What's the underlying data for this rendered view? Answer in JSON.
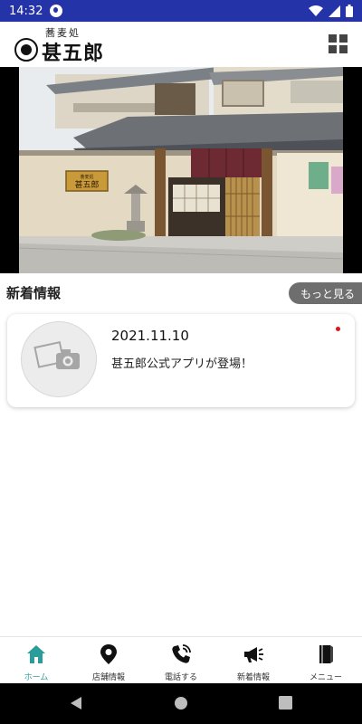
{
  "status_bar": {
    "time": "14:32",
    "bar_color": "#2533a8"
  },
  "header": {
    "logo_small": "蕎麦処",
    "logo_main": "甚五郎",
    "menu_icon": "grid-icon"
  },
  "hero": {
    "signboard_small": "蕎麦処",
    "signboard_main": "甚五郎"
  },
  "news": {
    "heading": "新着情報",
    "more_label": "もっと見る",
    "items": [
      {
        "date": "2021.11.10",
        "text": "甚五郎公式アプリが登場！",
        "unread": true,
        "thumbnail_icon": "photo-placeholder-icon"
      }
    ]
  },
  "bottom_nav": {
    "active_color": "#2a9d9a",
    "items": [
      {
        "label": "ホーム",
        "icon": "home-icon",
        "active": true
      },
      {
        "label": "店舗情報",
        "icon": "map-pin-icon",
        "active": false
      },
      {
        "label": "電話する",
        "icon": "phone-icon",
        "active": false
      },
      {
        "label": "新着情報",
        "icon": "megaphone-icon",
        "active": false
      },
      {
        "label": "メニュー",
        "icon": "book-icon",
        "active": false
      }
    ]
  },
  "system_nav": {
    "buttons": [
      "back-icon",
      "home-circle-icon",
      "recents-icon"
    ]
  }
}
